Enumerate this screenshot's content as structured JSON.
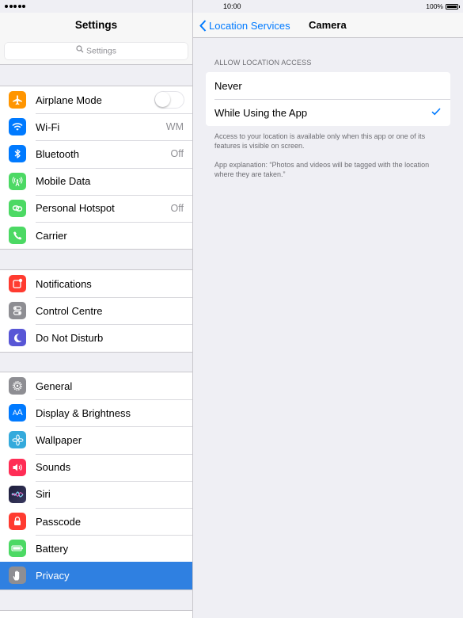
{
  "status": {
    "time": "10:00",
    "battery": "100%",
    "battery_level": 1.0,
    "signal_bars": 5
  },
  "sidebar": {
    "title": "Settings",
    "search_placeholder": "Settings",
    "groups": [
      {
        "items": [
          {
            "label": "Airplane Mode",
            "icon": "airplane-icon",
            "color": "#ff9500",
            "toggle": false
          },
          {
            "label": "Wi-Fi",
            "icon": "wifi-icon",
            "color": "#007aff",
            "value": "WM"
          },
          {
            "label": "Bluetooth",
            "icon": "bluetooth-icon",
            "color": "#007aff",
            "value": "Off"
          },
          {
            "label": "Mobile Data",
            "icon": "antenna-icon",
            "color": "#4cd964"
          },
          {
            "label": "Personal Hotspot",
            "icon": "hotspot-icon",
            "color": "#4cd964",
            "value": "Off"
          },
          {
            "label": "Carrier",
            "icon": "phone-icon",
            "color": "#4cd964"
          }
        ]
      },
      {
        "items": [
          {
            "label": "Notifications",
            "icon": "notifications-icon",
            "color": "#ff3b30"
          },
          {
            "label": "Control Centre",
            "icon": "control-centre-icon",
            "color": "#8e8e93"
          },
          {
            "label": "Do Not Disturb",
            "icon": "moon-icon",
            "color": "#5856d6"
          }
        ]
      },
      {
        "items": [
          {
            "label": "General",
            "icon": "gear-icon",
            "color": "#8e8e93"
          },
          {
            "label": "Display & Brightness",
            "icon": "display-icon",
            "color": "#007aff"
          },
          {
            "label": "Wallpaper",
            "icon": "wallpaper-icon",
            "color": "#34aadc"
          },
          {
            "label": "Sounds",
            "icon": "speaker-icon",
            "color": "#ff2d55"
          },
          {
            "label": "Siri",
            "icon": "siri-icon",
            "color": "#2b2b3a"
          },
          {
            "label": "Passcode",
            "icon": "lock-icon",
            "color": "#ff3b30"
          },
          {
            "label": "Battery",
            "icon": "battery-icon",
            "color": "#4cd964"
          },
          {
            "label": "Privacy",
            "icon": "hand-icon",
            "color": "#8e8e93",
            "selected": true
          }
        ]
      }
    ]
  },
  "detail": {
    "back_label": "Location Services",
    "title": "Camera",
    "section_header": "ALLOW LOCATION ACCESS",
    "options": [
      {
        "label": "Never",
        "checked": false
      },
      {
        "label": "While Using the App",
        "checked": true
      }
    ],
    "footer_note": "Access to your location is available only when this app or one of its features is visible on screen.",
    "app_explanation": "App explanation: “Photos and videos will be tagged with the location where they are taken.”"
  },
  "colors": {
    "accent": "#007aff",
    "selected_row": "#2f80e1"
  }
}
